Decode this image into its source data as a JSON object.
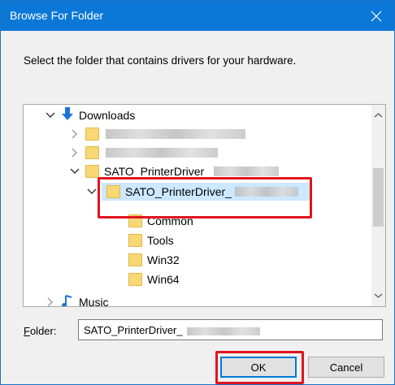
{
  "window": {
    "title": "Browse For Folder"
  },
  "instruction": "Select the folder that contains drivers for your hardware.",
  "tree": {
    "items": [
      {
        "label": "Downloads",
        "state": "expanded"
      },
      {
        "label": "",
        "state": "collapsed"
      },
      {
        "label": "",
        "state": "collapsed"
      },
      {
        "label": "SATO_PrinterDriver_",
        "state": "expanded"
      },
      {
        "label": "SATO_PrinterDriver_",
        "state": "expanded-selected"
      },
      {
        "label": "Common"
      },
      {
        "label": "Tools"
      },
      {
        "label": "Win32"
      },
      {
        "label": "Win64"
      },
      {
        "label": "Music",
        "state": "collapsed"
      }
    ]
  },
  "folder": {
    "label_prefix": "F",
    "label_rest": "older:",
    "value": "SATO_PrinterDriver_"
  },
  "buttons": {
    "ok": "OK",
    "cancel": "Cancel"
  },
  "colors": {
    "titlebar": "#0b78d7",
    "selection": "#cce8ff",
    "highlight_box": "#e0141e"
  }
}
